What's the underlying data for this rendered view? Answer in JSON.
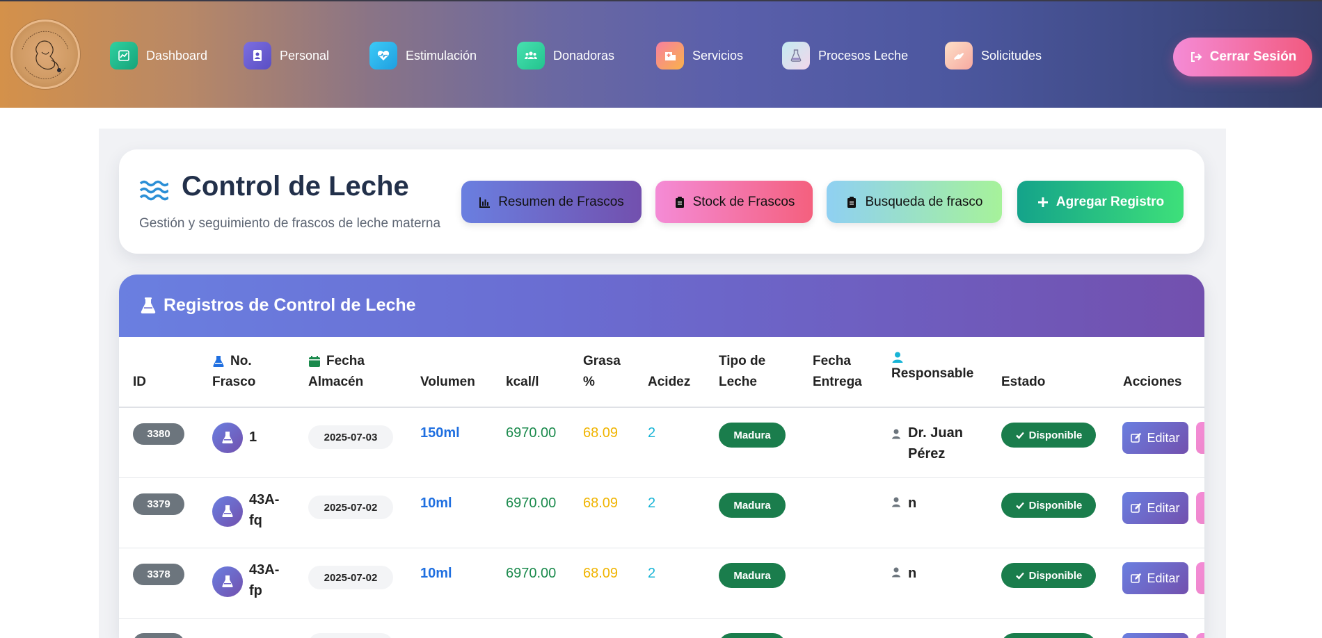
{
  "colors": {
    "accent_purple": "#6a7fe0",
    "accent_violet": "#7250ae",
    "success_green": "#1a7d4c",
    "badge_gray": "#6c757d"
  },
  "navbar": {
    "logo_alt": "Banco de Leche Humana",
    "items": [
      {
        "label": "Dashboard",
        "icon": "chart-line-icon",
        "color": "#20b486"
      },
      {
        "label": "Personal",
        "icon": "user-badge-icon",
        "color": "#6a5fd2"
      },
      {
        "label": "Estimulación",
        "icon": "heart-pulse-icon",
        "color": "#28b9f0"
      },
      {
        "label": "Donadoras",
        "icon": "users-icon",
        "color": "#2fd7a0"
      },
      {
        "label": "Servicios",
        "icon": "hospital-icon",
        "color": "#f67f6b"
      },
      {
        "label": "Procesos Leche",
        "icon": "flask-icon",
        "color": "#cfe8f5"
      },
      {
        "label": "Solicitudes",
        "icon": "hand-icon",
        "color": "#fbc6a8"
      }
    ],
    "logout_label": "Cerrar Sesión"
  },
  "header": {
    "title": "Control de Leche",
    "subtitle": "Gestión y seguimiento de frascos de leche materna",
    "buttons": {
      "resumen": "Resumen de Frascos",
      "stock": "Stock de Frascos",
      "busqueda": "Busqueda de frasco",
      "agregar": "Agregar Registro"
    }
  },
  "table": {
    "title": "Registros de Control de Leche",
    "columns": {
      "id": "ID",
      "no_frasco_1": "No.",
      "no_frasco_2": "Frasco",
      "fecha_almacen_1": "Fecha",
      "fecha_almacen_2": "Almacén",
      "volumen": "Volumen",
      "kcal": "kcal/l",
      "grasa_1": "Grasa",
      "grasa_2": "%",
      "acidez": "Acidez",
      "tipo_1": "Tipo de",
      "tipo_2": "Leche",
      "fecha_entrega_1": "Fecha",
      "fecha_entrega_2": "Entrega",
      "responsable": "Responsable",
      "estado": "Estado",
      "acciones": "Acciones"
    },
    "edit_label": "Editar",
    "rows": [
      {
        "id": "3380",
        "frasco": [
          "1"
        ],
        "fecha": "2025-07-03",
        "volumen": "150ml",
        "kcal": "6970.00",
        "grasa": "68.09",
        "acidez": "2",
        "tipo": "Madura",
        "entrega": "",
        "responsable": [
          "Dr. Juan",
          "Pérez"
        ],
        "estado": "Disponible"
      },
      {
        "id": "3379",
        "frasco": [
          "43A-",
          "fq"
        ],
        "fecha": "2025-07-02",
        "volumen": "10ml",
        "kcal": "6970.00",
        "grasa": "68.09",
        "acidez": "2",
        "tipo": "Madura",
        "entrega": "",
        "responsable": [
          "n"
        ],
        "estado": "Disponible"
      },
      {
        "id": "3378",
        "frasco": [
          "43A-",
          "fp"
        ],
        "fecha": "2025-07-02",
        "volumen": "10ml",
        "kcal": "6970.00",
        "grasa": "68.09",
        "acidez": "2",
        "tipo": "Madura",
        "entrega": "",
        "responsable": [
          "n"
        ],
        "estado": "Disponible"
      }
    ]
  }
}
